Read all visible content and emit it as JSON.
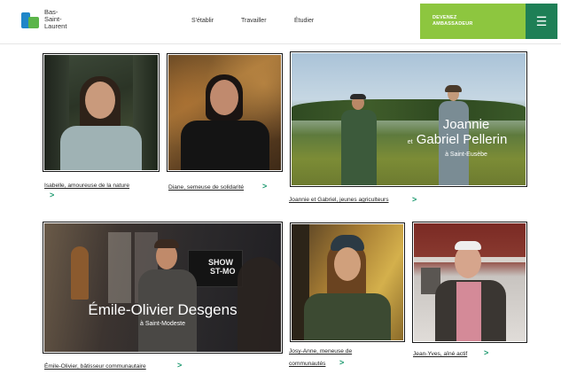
{
  "header": {
    "logo_lines": [
      "Bas-",
      "Saint-",
      "Laurent"
    ],
    "nav": [
      "S'établir",
      "Travailler",
      "Étudier"
    ],
    "cta_lines": [
      "DEVENEZ",
      "AMBASSADEUR"
    ],
    "menu_icon": "hamburger-icon"
  },
  "cards": {
    "isabelle": {
      "caption": "Isabelle, amoureuse de la nature"
    },
    "diane": {
      "caption": "Diane, semeuse de solidarité"
    },
    "joannie": {
      "caption": "Joannie et Gabriel, jeunes agriculteurs",
      "title_line1": "Joannie",
      "title_et": "et",
      "title_line2": "Gabriel Pellerin",
      "place": "à Saint-Eusèbe"
    },
    "emile": {
      "caption": "Émile-Olivier, bâtisseur communautaire",
      "title": "Émile-Olivier Desgens",
      "place": "à Saint-Modeste",
      "screen_text_1": "SHOW",
      "screen_text_2": "ST-MO"
    },
    "josy": {
      "caption_line1": "Josy-Anne, meneuse de",
      "caption_line2": "communautés"
    },
    "jeanyves": {
      "caption": "Jean-Yves, aîné actif"
    }
  },
  "chevron": ">",
  "colors": {
    "accent_green": "#8dc63f",
    "dark_green": "#1e7f56",
    "chevron": "#1e9a70"
  }
}
